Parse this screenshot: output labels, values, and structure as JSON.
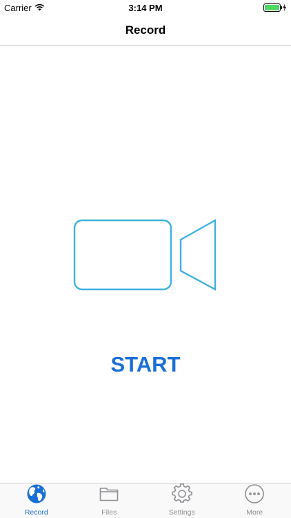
{
  "status_bar": {
    "carrier": "Carrier",
    "time": "3:14 PM",
    "wifi_icon": "wifi-icon",
    "battery_icon": "battery-charging-icon",
    "battery_color": "#4cd964"
  },
  "nav": {
    "title": "Record"
  },
  "main": {
    "camera_icon": "video-camera-icon",
    "camera_color": "#3db0e0",
    "start_label": "START",
    "start_color": "#1a6fd6"
  },
  "tab_bar": {
    "active_color": "#1a6fd6",
    "inactive_color": "#8e8e93",
    "tabs": [
      {
        "label": "Record",
        "icon": "globe-icon",
        "active": true
      },
      {
        "label": "Files",
        "icon": "folder-icon",
        "active": false
      },
      {
        "label": "Settings",
        "icon": "gear-icon",
        "active": false
      },
      {
        "label": "More",
        "icon": "more-icon",
        "active": false
      }
    ]
  }
}
